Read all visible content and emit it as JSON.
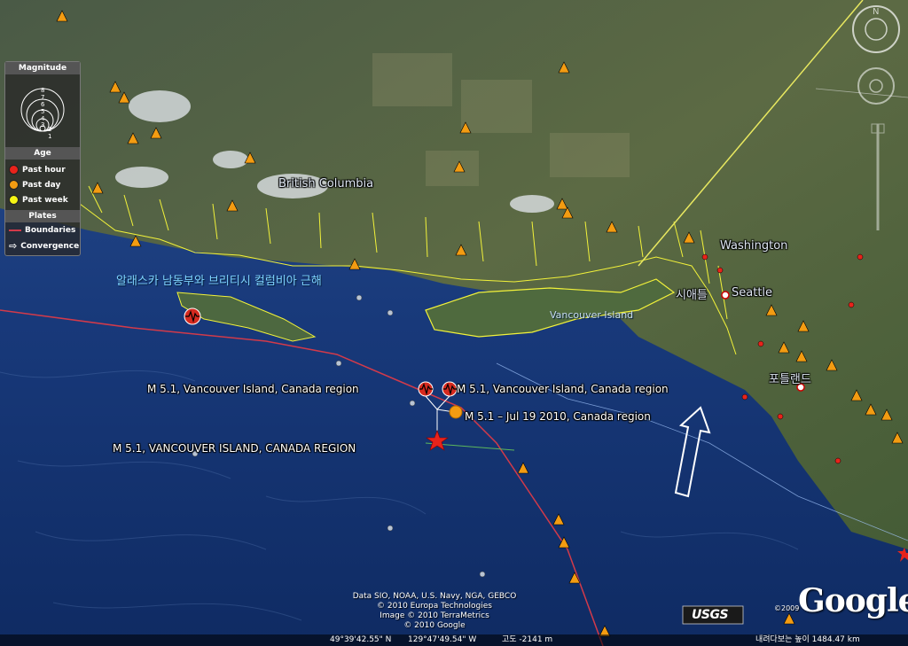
{
  "map": {
    "place_labels": {
      "british_columbia": "British Columbia",
      "washington": "Washington",
      "seattle": "Seattle",
      "seattle_korean": "시애틀",
      "portland_korean": "포틀랜드",
      "vancouver_island": "Vancouver Island",
      "sea_korean": "알래스카 남동부와 브리티시 컬럼비아 근해"
    },
    "earthquake_labels": {
      "eq_left": "M 5.1, Vancouver Island, Canada region",
      "eq_right": "M 5.1, Vancouver Island, Canada region",
      "eq_dated": "M 5.1 – Jul 19 2010, Canada region",
      "eq_star": "M 5.1, VANCOUVER ISLAND, CANADA REGION"
    },
    "colors": {
      "ocean": "#13306a",
      "land": "#3d5a32",
      "coastline": "#f2f23a",
      "plate_boundary": "#d23a4a",
      "past_hour": "#e8231b",
      "past_day": "#f39c12",
      "past_week": "#f5f514"
    }
  },
  "legend": {
    "magnitude_title": "Magnitude",
    "magnitude_scale": [
      "8",
      "7",
      "6",
      "5",
      "4",
      "3",
      "2",
      "1"
    ],
    "age_title": "Age",
    "past_hour": "Past hour",
    "past_day": "Past day",
    "past_week": "Past week",
    "plates_title": "Plates",
    "boundaries": "Boundaries",
    "convergence": "Convergence"
  },
  "attribution": {
    "line1": "Data SIO, NOAA, U.S. Navy, NGA, GEBCO",
    "line2": "© 2010 Europa Technologies",
    "line3": "Image © 2010 TerraMetrics",
    "line4": "© 2010 Google"
  },
  "branding": {
    "usgs": "USGS",
    "google": "Google",
    "copyright_year": "©2009"
  },
  "status_bar": {
    "latitude": "49°39'42.55\" N",
    "longitude": "129°47'49.54\" W",
    "elevation": "고도 -2141 m",
    "eye_altitude": "내려다보는 높이  1484.47 km"
  }
}
